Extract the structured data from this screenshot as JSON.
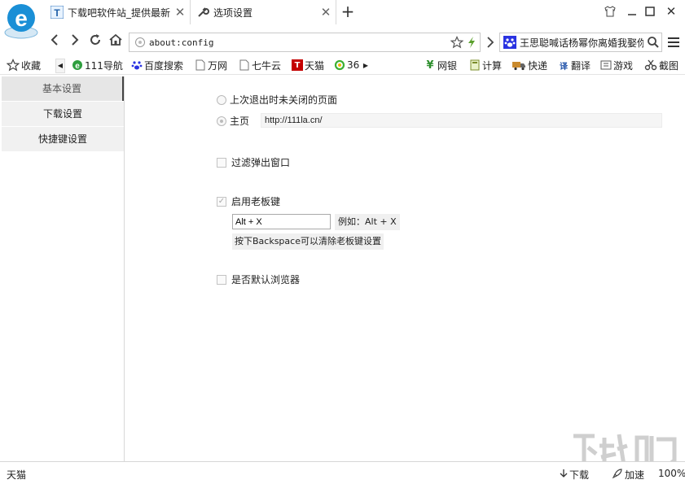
{
  "tabs": [
    {
      "title": "下载吧软件站_提供最新",
      "icon": "xiazaiba-icon"
    },
    {
      "title": "选项设置",
      "icon": "wrench-icon"
    }
  ],
  "new_tab_label": "+",
  "address": {
    "url": "about:config"
  },
  "search": {
    "value": "王思聪喊话杨幂你离婚我娶你"
  },
  "bookmarks": {
    "favorites_label": "收藏",
    "left": [
      {
        "label": "111导航",
        "icon": "e-icon"
      },
      {
        "label": "百度搜索",
        "icon": "baidu-paw-icon"
      },
      {
        "label": "万网",
        "icon": "page-icon"
      },
      {
        "label": "七牛云",
        "icon": "page-icon"
      },
      {
        "label": "天猫",
        "icon": "tmall-icon"
      },
      {
        "label": "36",
        "icon": "qihoo-icon"
      }
    ],
    "right": [
      {
        "label": "网银",
        "icon": "yen-icon"
      },
      {
        "label": "计算",
        "icon": "calculator-icon"
      },
      {
        "label": "快递",
        "icon": "truck-icon"
      },
      {
        "label": "翻译",
        "icon": "translate-icon"
      },
      {
        "label": "游戏",
        "icon": "game-icon"
      },
      {
        "label": "截图",
        "icon": "scissors-icon"
      }
    ]
  },
  "sidebar": {
    "items": [
      {
        "label": "基本设置",
        "active": true
      },
      {
        "label": "下载设置",
        "active": false
      },
      {
        "label": "快捷键设置",
        "active": false
      }
    ]
  },
  "settings": {
    "restore_label": "上次退出时未关闭的页面",
    "homepage_label": "主页",
    "homepage_value": "http://111la.cn/",
    "popup_label": "过滤弹出窗口",
    "bosskey_label": "启用老板键",
    "bosskey_value": "Alt + X",
    "bosskey_example": "例如：Alt + X",
    "bosskey_clear": "按下Backspace可以清除老板键设置",
    "default_browser_label": "是否默认浏览器"
  },
  "status": {
    "left_text": "天猫",
    "download_label": "下载",
    "speedup_label": "加速",
    "zoom": "100%"
  },
  "colors": {
    "accent": "#1a8fd6",
    "tmall_red": "#c40000",
    "baidu_blue": "#2932e1"
  }
}
